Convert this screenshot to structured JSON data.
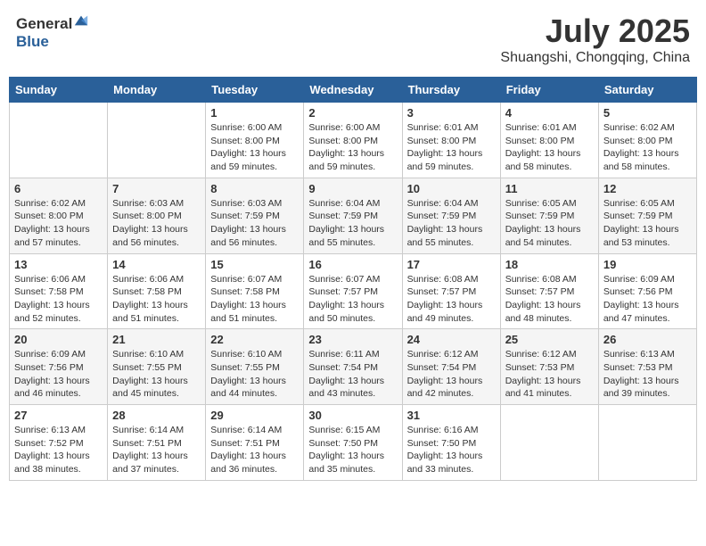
{
  "header": {
    "logo_general": "General",
    "logo_blue": "Blue",
    "month_year": "July 2025",
    "location": "Shuangshi, Chongqing, China"
  },
  "weekdays": [
    "Sunday",
    "Monday",
    "Tuesday",
    "Wednesday",
    "Thursday",
    "Friday",
    "Saturday"
  ],
  "weeks": [
    [
      {
        "day": "",
        "sunrise": "",
        "sunset": "",
        "daylight": ""
      },
      {
        "day": "",
        "sunrise": "",
        "sunset": "",
        "daylight": ""
      },
      {
        "day": "1",
        "sunrise": "Sunrise: 6:00 AM",
        "sunset": "Sunset: 8:00 PM",
        "daylight": "Daylight: 13 hours and 59 minutes."
      },
      {
        "day": "2",
        "sunrise": "Sunrise: 6:00 AM",
        "sunset": "Sunset: 8:00 PM",
        "daylight": "Daylight: 13 hours and 59 minutes."
      },
      {
        "day": "3",
        "sunrise": "Sunrise: 6:01 AM",
        "sunset": "Sunset: 8:00 PM",
        "daylight": "Daylight: 13 hours and 59 minutes."
      },
      {
        "day": "4",
        "sunrise": "Sunrise: 6:01 AM",
        "sunset": "Sunset: 8:00 PM",
        "daylight": "Daylight: 13 hours and 58 minutes."
      },
      {
        "day": "5",
        "sunrise": "Sunrise: 6:02 AM",
        "sunset": "Sunset: 8:00 PM",
        "daylight": "Daylight: 13 hours and 58 minutes."
      }
    ],
    [
      {
        "day": "6",
        "sunrise": "Sunrise: 6:02 AM",
        "sunset": "Sunset: 8:00 PM",
        "daylight": "Daylight: 13 hours and 57 minutes."
      },
      {
        "day": "7",
        "sunrise": "Sunrise: 6:03 AM",
        "sunset": "Sunset: 8:00 PM",
        "daylight": "Daylight: 13 hours and 56 minutes."
      },
      {
        "day": "8",
        "sunrise": "Sunrise: 6:03 AM",
        "sunset": "Sunset: 7:59 PM",
        "daylight": "Daylight: 13 hours and 56 minutes."
      },
      {
        "day": "9",
        "sunrise": "Sunrise: 6:04 AM",
        "sunset": "Sunset: 7:59 PM",
        "daylight": "Daylight: 13 hours and 55 minutes."
      },
      {
        "day": "10",
        "sunrise": "Sunrise: 6:04 AM",
        "sunset": "Sunset: 7:59 PM",
        "daylight": "Daylight: 13 hours and 55 minutes."
      },
      {
        "day": "11",
        "sunrise": "Sunrise: 6:05 AM",
        "sunset": "Sunset: 7:59 PM",
        "daylight": "Daylight: 13 hours and 54 minutes."
      },
      {
        "day": "12",
        "sunrise": "Sunrise: 6:05 AM",
        "sunset": "Sunset: 7:59 PM",
        "daylight": "Daylight: 13 hours and 53 minutes."
      }
    ],
    [
      {
        "day": "13",
        "sunrise": "Sunrise: 6:06 AM",
        "sunset": "Sunset: 7:58 PM",
        "daylight": "Daylight: 13 hours and 52 minutes."
      },
      {
        "day": "14",
        "sunrise": "Sunrise: 6:06 AM",
        "sunset": "Sunset: 7:58 PM",
        "daylight": "Daylight: 13 hours and 51 minutes."
      },
      {
        "day": "15",
        "sunrise": "Sunrise: 6:07 AM",
        "sunset": "Sunset: 7:58 PM",
        "daylight": "Daylight: 13 hours and 51 minutes."
      },
      {
        "day": "16",
        "sunrise": "Sunrise: 6:07 AM",
        "sunset": "Sunset: 7:57 PM",
        "daylight": "Daylight: 13 hours and 50 minutes."
      },
      {
        "day": "17",
        "sunrise": "Sunrise: 6:08 AM",
        "sunset": "Sunset: 7:57 PM",
        "daylight": "Daylight: 13 hours and 49 minutes."
      },
      {
        "day": "18",
        "sunrise": "Sunrise: 6:08 AM",
        "sunset": "Sunset: 7:57 PM",
        "daylight": "Daylight: 13 hours and 48 minutes."
      },
      {
        "day": "19",
        "sunrise": "Sunrise: 6:09 AM",
        "sunset": "Sunset: 7:56 PM",
        "daylight": "Daylight: 13 hours and 47 minutes."
      }
    ],
    [
      {
        "day": "20",
        "sunrise": "Sunrise: 6:09 AM",
        "sunset": "Sunset: 7:56 PM",
        "daylight": "Daylight: 13 hours and 46 minutes."
      },
      {
        "day": "21",
        "sunrise": "Sunrise: 6:10 AM",
        "sunset": "Sunset: 7:55 PM",
        "daylight": "Daylight: 13 hours and 45 minutes."
      },
      {
        "day": "22",
        "sunrise": "Sunrise: 6:10 AM",
        "sunset": "Sunset: 7:55 PM",
        "daylight": "Daylight: 13 hours and 44 minutes."
      },
      {
        "day": "23",
        "sunrise": "Sunrise: 6:11 AM",
        "sunset": "Sunset: 7:54 PM",
        "daylight": "Daylight: 13 hours and 43 minutes."
      },
      {
        "day": "24",
        "sunrise": "Sunrise: 6:12 AM",
        "sunset": "Sunset: 7:54 PM",
        "daylight": "Daylight: 13 hours and 42 minutes."
      },
      {
        "day": "25",
        "sunrise": "Sunrise: 6:12 AM",
        "sunset": "Sunset: 7:53 PM",
        "daylight": "Daylight: 13 hours and 41 minutes."
      },
      {
        "day": "26",
        "sunrise": "Sunrise: 6:13 AM",
        "sunset": "Sunset: 7:53 PM",
        "daylight": "Daylight: 13 hours and 39 minutes."
      }
    ],
    [
      {
        "day": "27",
        "sunrise": "Sunrise: 6:13 AM",
        "sunset": "Sunset: 7:52 PM",
        "daylight": "Daylight: 13 hours and 38 minutes."
      },
      {
        "day": "28",
        "sunrise": "Sunrise: 6:14 AM",
        "sunset": "Sunset: 7:51 PM",
        "daylight": "Daylight: 13 hours and 37 minutes."
      },
      {
        "day": "29",
        "sunrise": "Sunrise: 6:14 AM",
        "sunset": "Sunset: 7:51 PM",
        "daylight": "Daylight: 13 hours and 36 minutes."
      },
      {
        "day": "30",
        "sunrise": "Sunrise: 6:15 AM",
        "sunset": "Sunset: 7:50 PM",
        "daylight": "Daylight: 13 hours and 35 minutes."
      },
      {
        "day": "31",
        "sunrise": "Sunrise: 6:16 AM",
        "sunset": "Sunset: 7:50 PM",
        "daylight": "Daylight: 13 hours and 33 minutes."
      },
      {
        "day": "",
        "sunrise": "",
        "sunset": "",
        "daylight": ""
      },
      {
        "day": "",
        "sunrise": "",
        "sunset": "",
        "daylight": ""
      }
    ]
  ]
}
